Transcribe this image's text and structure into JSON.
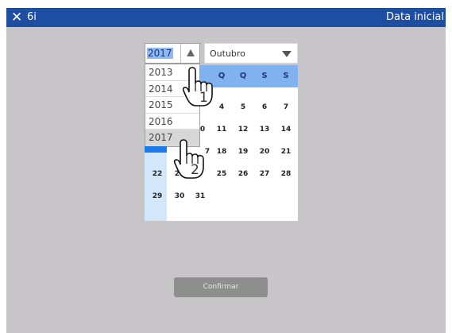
{
  "topbar": {
    "close_icon": "close-icon",
    "app_number": "6i",
    "title": "Data inicial"
  },
  "year_field": {
    "value": "2017",
    "arrow_icon": "triangle-up-icon"
  },
  "month_field": {
    "value": "Outubro",
    "arrow_icon": "triangle-down-icon"
  },
  "year_dropdown": {
    "options": [
      "2013",
      "2014",
      "2015",
      "2016",
      "2017"
    ],
    "selected": "2017"
  },
  "calendar": {
    "visible_weekdays": [
      "Q",
      "Q",
      "S",
      "S"
    ],
    "rows": [
      [
        "4",
        "5",
        "6",
        "7"
      ],
      [
        "0",
        "11",
        "12",
        "13",
        "14"
      ],
      [
        "7",
        "18",
        "19",
        "20",
        "21"
      ],
      [
        "22",
        "23",
        "25",
        "26",
        "27",
        "28"
      ],
      [
        "29",
        "30",
        "31"
      ]
    ],
    "header_color": "#7fb2ee",
    "highlight_color": "#1d7be9"
  },
  "annotations": {
    "step_1": "1",
    "step_2": "2"
  },
  "confirm_button": {
    "label": "Confirmar"
  },
  "colors": {
    "topbar": "#1e4ea1",
    "background": "#c8c5c8",
    "button": "#8c8f8c"
  }
}
